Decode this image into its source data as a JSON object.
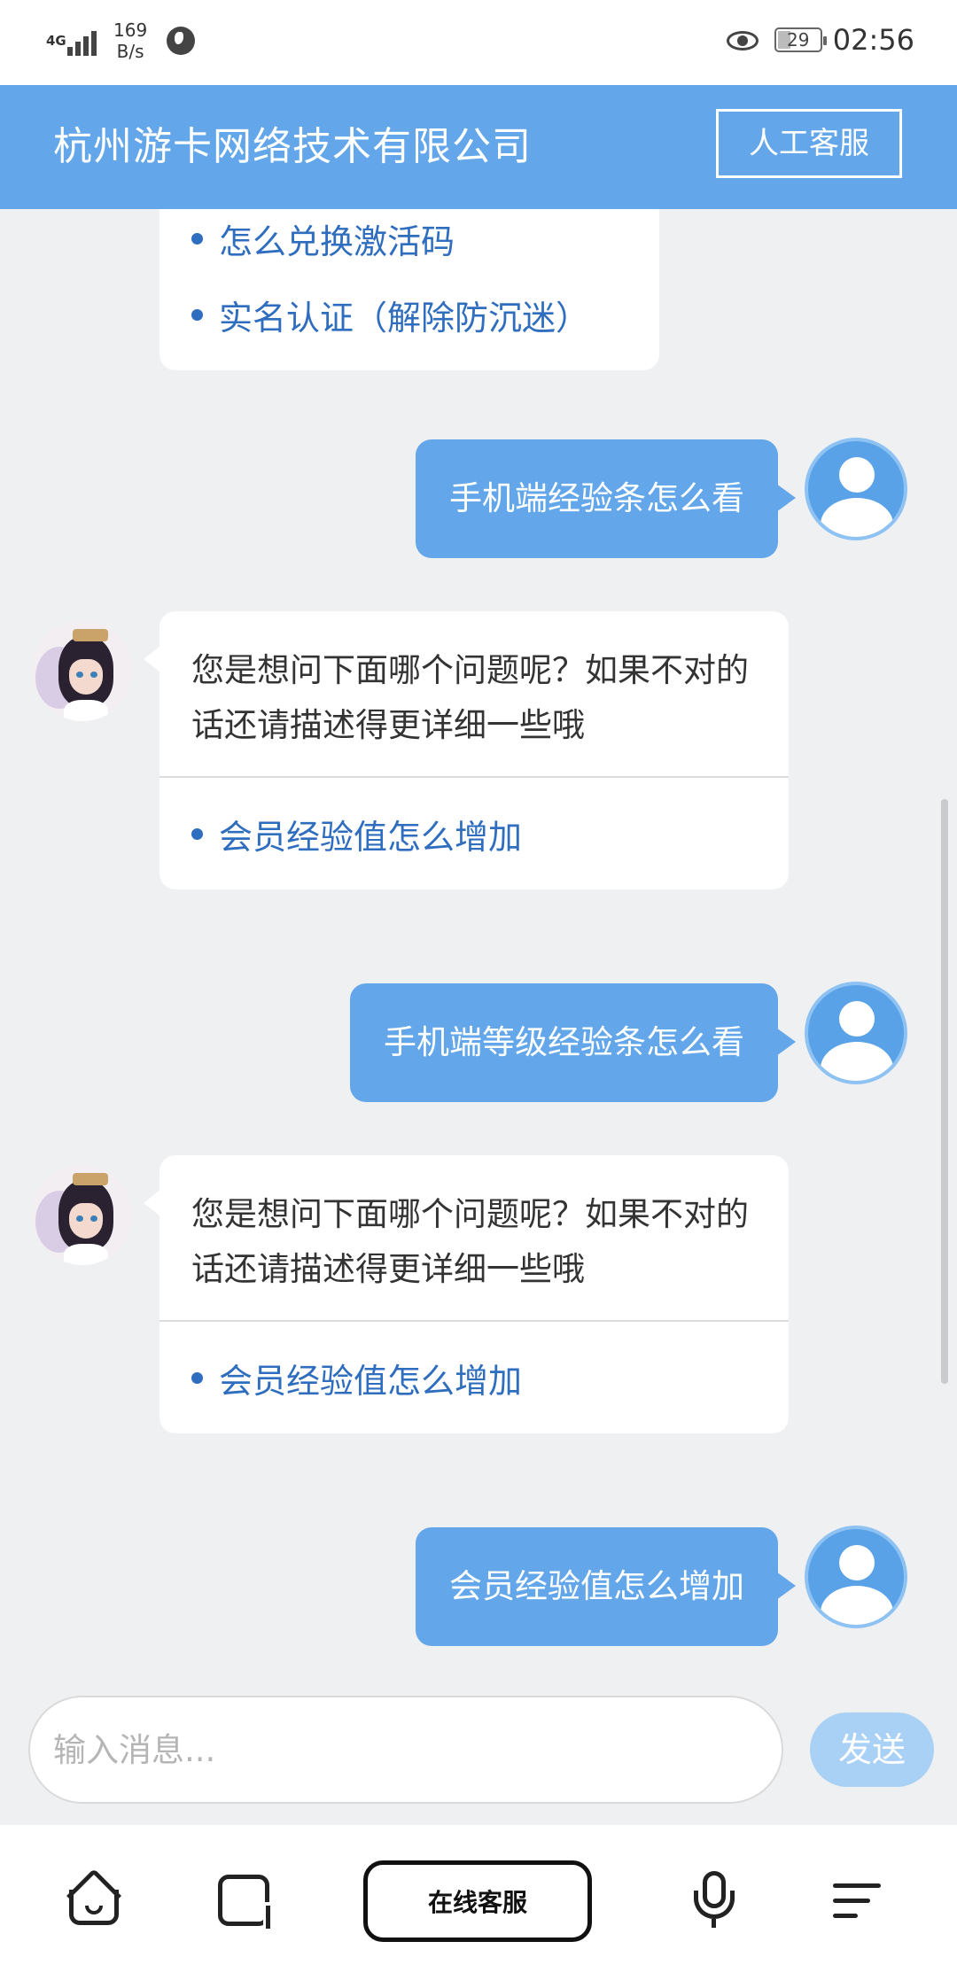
{
  "status_bar": {
    "network": "4G",
    "speed_value": "169",
    "speed_unit": "B/s",
    "battery": "29",
    "time": "02:56"
  },
  "header": {
    "title": "杭州游卡网络技术有限公司",
    "agent_button": "人工客服"
  },
  "chat": {
    "partial_bot": {
      "links": [
        "怎么兑换激活码",
        "实名认证（解除防沉迷）"
      ]
    },
    "messages": [
      {
        "from": "user",
        "text": "手机端经验条怎么看"
      },
      {
        "from": "bot",
        "text": "您是想问下面哪个问题呢？如果不对的话还请描述得更详细一些哦",
        "links": [
          "会员经验值怎么增加"
        ]
      },
      {
        "from": "user",
        "text": "手机端等级经验条怎么看"
      },
      {
        "from": "bot",
        "text": "您是想问下面哪个问题呢？如果不对的话还请描述得更详细一些哦",
        "links": [
          "会员经验值怎么增加"
        ]
      },
      {
        "from": "user",
        "text": "会员经验值怎么增加"
      }
    ]
  },
  "input": {
    "placeholder": "输入消息...",
    "send_label": "发送"
  },
  "bottom_nav": {
    "service_label": "在线客服",
    "icons": [
      "home-icon",
      "tabs-icon",
      "microphone-icon",
      "menu-icon"
    ]
  },
  "colors": {
    "brand": "#63a7ea",
    "link": "#2f6dbf",
    "background": "#eff0f2",
    "send_disabled": "#a9d0f5"
  }
}
